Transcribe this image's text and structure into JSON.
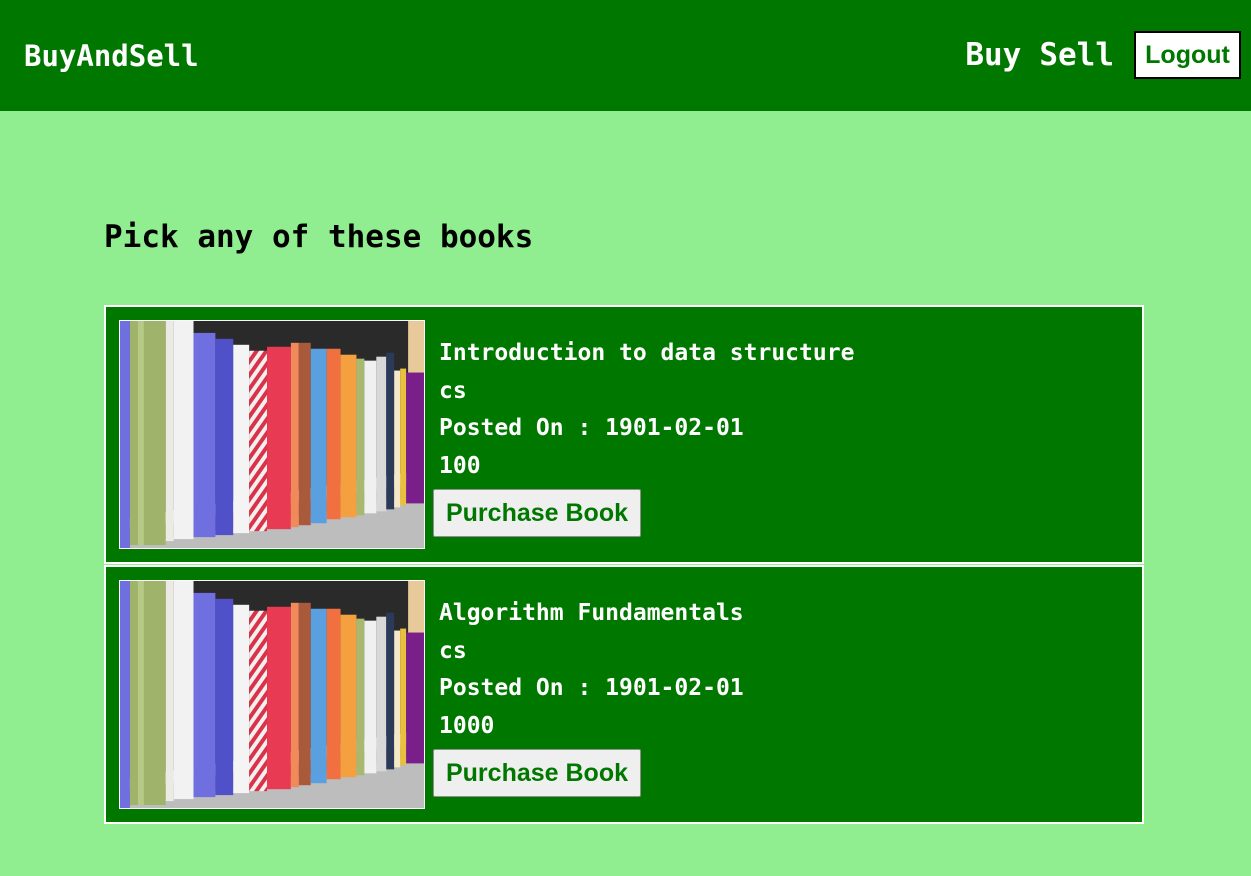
{
  "navbar": {
    "brand": "BuyAndSell",
    "links": {
      "buy": "Buy",
      "sell": "Sell"
    },
    "logout_label": "Logout"
  },
  "page": {
    "title": "Pick any of these books"
  },
  "books": [
    {
      "title": "Introduction to data structure",
      "category": "cs",
      "posted_on": "Posted On : 1901-02-01",
      "price": "100",
      "button_label": "Purchase Book"
    },
    {
      "title": "Algorithm Fundamentals",
      "category": "cs",
      "posted_on": "Posted On : 1901-02-01",
      "price": "1000",
      "button_label": "Purchase Book"
    }
  ],
  "colors": {
    "navbar": "#007800",
    "background": "#90ee90",
    "card": "#007800"
  }
}
